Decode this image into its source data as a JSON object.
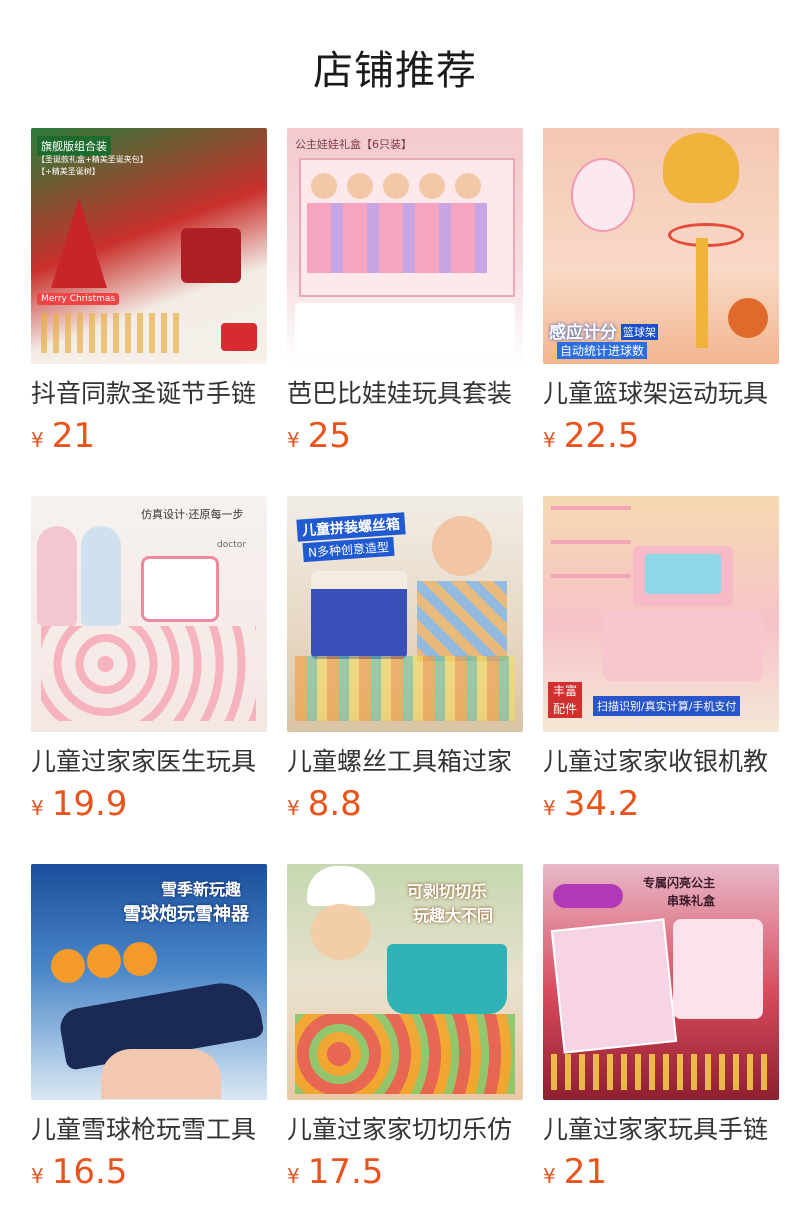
{
  "section": {
    "title": "店铺推荐"
  },
  "products": [
    {
      "name": "抖音同款圣诞节手链",
      "currency": "¥",
      "price": "21"
    },
    {
      "name": "芭巴比娃娃玩具套装",
      "currency": "¥",
      "price": "25"
    },
    {
      "name": "儿童篮球架运动玩具",
      "currency": "¥",
      "price": "22.5"
    },
    {
      "name": "儿童过家家医生玩具",
      "currency": "¥",
      "price": "19.9"
    },
    {
      "name": "儿童螺丝工具箱过家",
      "currency": "¥",
      "price": "8.8"
    },
    {
      "name": "儿童过家家收银机教",
      "currency": "¥",
      "price": "34.2"
    },
    {
      "name": "儿童雪球枪玩雪工具",
      "currency": "¥",
      "price": "16.5"
    },
    {
      "name": "儿童过家家切切乐仿",
      "currency": "¥",
      "price": "17.5"
    },
    {
      "name": "儿童过家家玩具手链",
      "currency": "¥",
      "price": "21"
    }
  ],
  "image_text": {
    "p1": {
      "badge": "旗舰版组合装",
      "line1": "【圣诞款礼盒+精美圣诞夹包】",
      "line2": "【+精美圣诞树】",
      "banner": "Merry Christmas"
    },
    "p2": {
      "header": "公主娃娃礼盒【6只装】"
    },
    "p3": {
      "headline": "感应计分",
      "tag": "篮球架",
      "sub": "自动统计进球数"
    },
    "p4": {
      "headline": "仿真设计·还原每一步",
      "word": "doctor"
    },
    "p5": {
      "headline": "儿童拼装螺丝箱",
      "sub": "N多种创意造型"
    },
    "p6": {
      "badge": "丰富配件",
      "bar": "扫描识别/真实计算/手机支付"
    },
    "p7": {
      "headline": "雪季新玩趣",
      "sub": "雪球炮玩雪神器"
    },
    "p8": {
      "headline": "可剥切切乐",
      "sub": "玩趣大不同"
    },
    "p9": {
      "headline": "专属闪亮公主",
      "sub": "串珠礼盒"
    }
  },
  "colors": {
    "price": "#e8541c",
    "title": "#1a1a1a",
    "name": "#333333"
  }
}
